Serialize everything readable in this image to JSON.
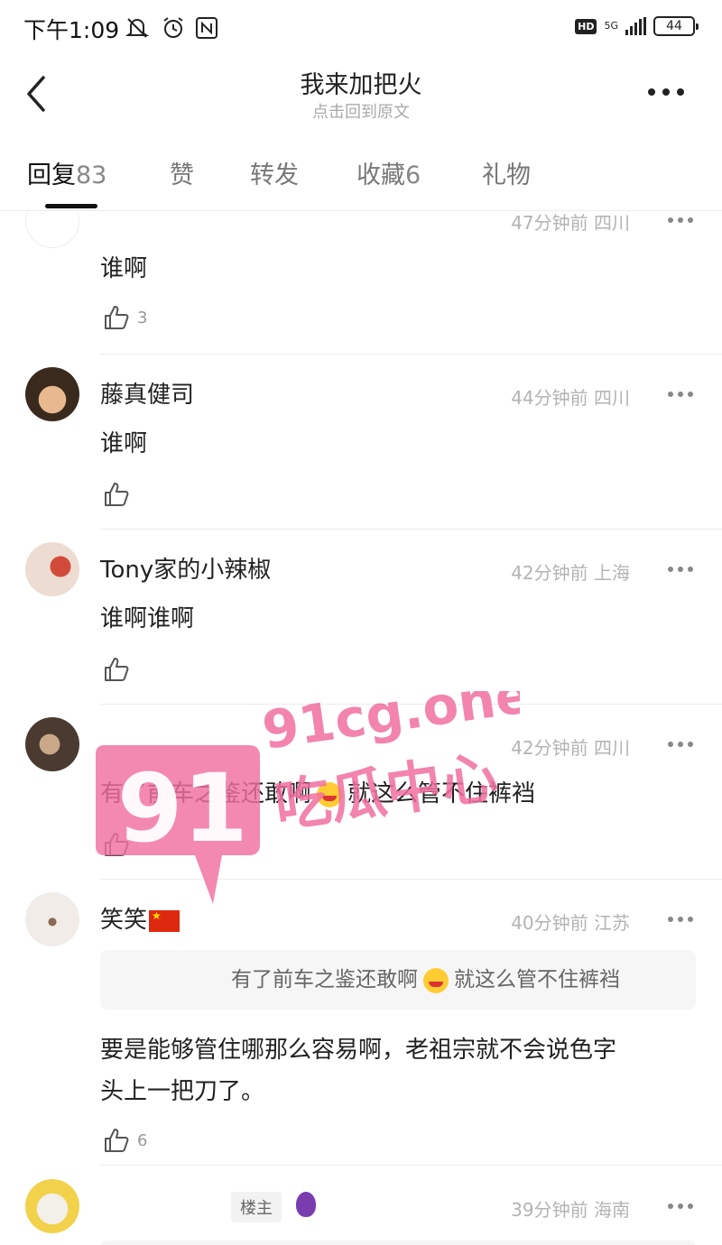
{
  "status_bar": {
    "time": "下午1:09",
    "network": "5G",
    "battery": "44"
  },
  "nav": {
    "title": "我来加把火",
    "subtitle": "点击回到原文"
  },
  "tabs": [
    {
      "label": "回复",
      "count": "83",
      "active": true
    },
    {
      "label": "赞",
      "count": ""
    },
    {
      "label": "转发",
      "count": ""
    },
    {
      "label": "收藏",
      "count": "6"
    },
    {
      "label": "礼物",
      "count": ""
    }
  ],
  "comments": [
    {
      "user": "",
      "time": "47分钟前",
      "location": "四川",
      "text": "谁啊",
      "likes": "3"
    },
    {
      "user": "藤真健司",
      "time": "44分钟前",
      "location": "四川",
      "text": "谁啊",
      "likes": ""
    },
    {
      "user": "Tony家的小辣椒",
      "time": "42分钟前",
      "location": "上海",
      "text": "谁啊谁啊",
      "likes": ""
    },
    {
      "user": "",
      "time": "42分钟前",
      "location": "四川",
      "text_a": "有了前车之鉴还敢啊",
      "text_b": "就这么管不住裤裆",
      "likes": ""
    },
    {
      "user": "笑笑",
      "time": "40分钟前",
      "location": "江苏",
      "quote_a": "有了前车之鉴还敢啊",
      "quote_b": "就这么管不住裤裆",
      "text_line1": "要是能够管住哪那么容易啊，老祖宗就不会说色字",
      "text_line2": "头上一把刀了。",
      "likes": "6"
    },
    {
      "user": "",
      "badge": "楼主",
      "time": "39分钟前",
      "location": "海南"
    }
  ],
  "watermark": {
    "number": "91",
    "site": "91cg.one",
    "name": "吃瓜中心"
  }
}
